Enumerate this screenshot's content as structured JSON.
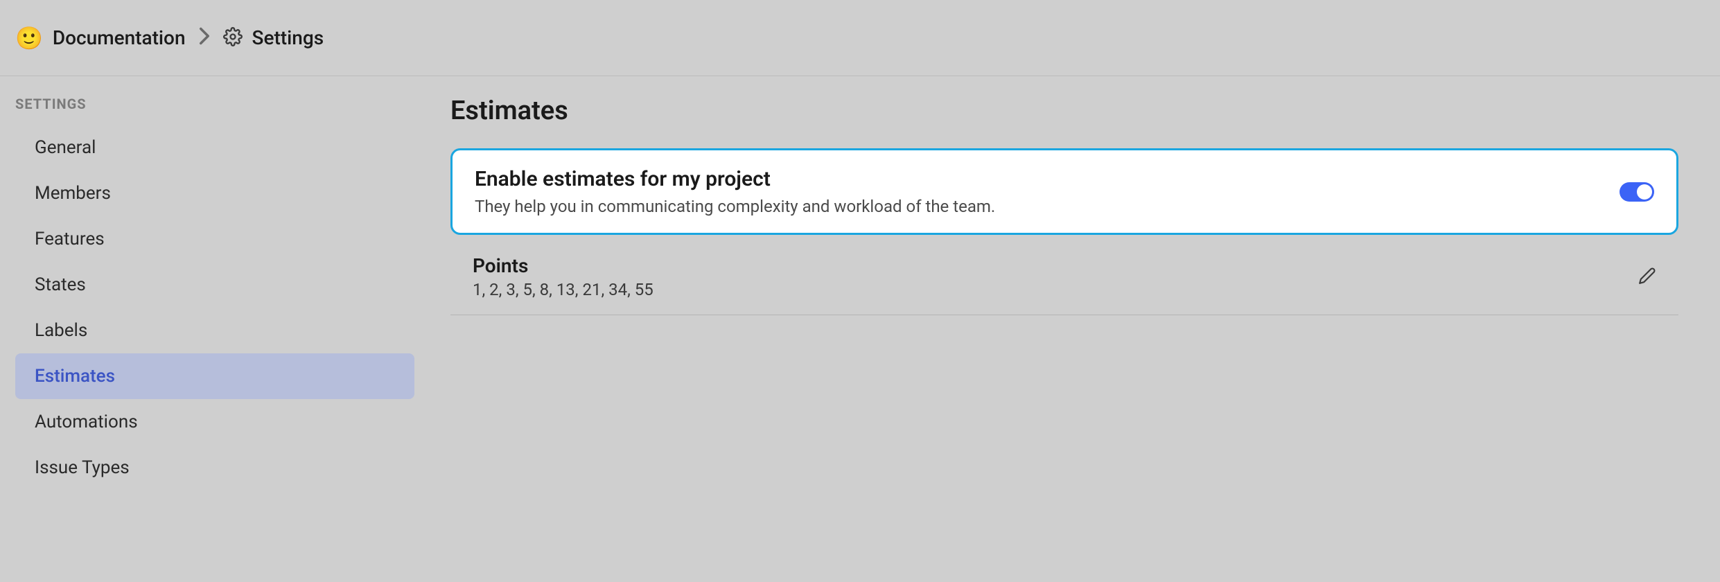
{
  "breadcrumb": {
    "project_emoji": "🙂",
    "project_name": "Documentation",
    "page_name": "Settings"
  },
  "sidebar": {
    "heading": "SETTINGS",
    "items": [
      {
        "label": "General",
        "active": false
      },
      {
        "label": "Members",
        "active": false
      },
      {
        "label": "Features",
        "active": false
      },
      {
        "label": "States",
        "active": false
      },
      {
        "label": "Labels",
        "active": false
      },
      {
        "label": "Estimates",
        "active": true
      },
      {
        "label": "Automations",
        "active": false
      },
      {
        "label": "Issue Types",
        "active": false
      }
    ]
  },
  "main": {
    "title": "Estimates",
    "enable_card": {
      "title": "Enable estimates for my project",
      "subtitle": "They help you in communicating complexity and workload of the team.",
      "enabled": true
    },
    "points_row": {
      "title": "Points",
      "values": "1, 2, 3, 5, 8, 13, 21, 34, 55"
    }
  }
}
